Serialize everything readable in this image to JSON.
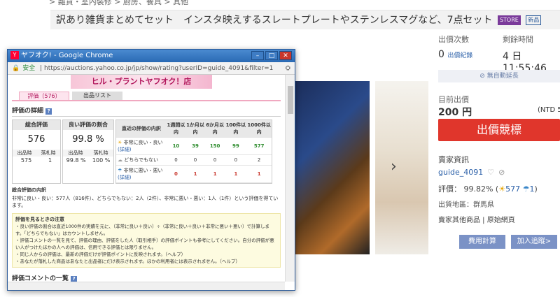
{
  "page": {
    "breadcrumb": "> 雜貨・室內裝修 > 廚房、餐具 > 其他",
    "title": "訳あり雑貨まとめてセット　インスタ映えするスレートプレートやステンレスマグなど、7点セット",
    "badge_store": "STORE",
    "badge_new": "新品"
  },
  "panel": {
    "bids_label": "出價次數",
    "bids_value": "0",
    "bids_link": "出價紀錄",
    "time_label": "剩餘時間",
    "time_value": "4 日 11:55:46",
    "auto_extend": "無自動延長",
    "current_label": "目前出價",
    "current_value": "200 円",
    "ntd": "(NTD 5",
    "bid_button": "出價競標",
    "seller_title": "賣家資訊",
    "seller_name": "guide_4091",
    "rating_prefix": "評價： 99.82% (",
    "rating_pos": "577",
    "rating_neg": "1",
    "rating_suffix": ")",
    "location": "出貨地區：群馬県",
    "other_goods": "賣家其他商品 | 原始網頁",
    "calc_button": "費用計算",
    "watch_button": "加入追蹤>"
  },
  "popup": {
    "window_title": "ヤフオク! - Google Chrome",
    "secure": "安全",
    "url": "https://auctions.yahoo.co.jp/jp/show/rating?userID=guide_4091&filter=1",
    "banner": "ヒル・プラントヤフオク！店",
    "tab_rating": "評価（576）",
    "tab_list": "出品リスト",
    "details_heading": "評価の詳細",
    "overall_label": "総合評価",
    "overall_value": "576",
    "good_ratio_label": "良い評価の割合",
    "good_ratio_value": "99.8 %",
    "seller_col": "出品時",
    "buyer_col": "落札時",
    "seller_count": "575",
    "buyer_count": "1",
    "seller_ratio": "99.8 %",
    "buyer_ratio": "100 %",
    "recent_header": "直近の評価の内訳",
    "periods": [
      "1週間以内",
      "1か月以内",
      "6か月以内",
      "100件以内",
      "1000件以内"
    ],
    "rows": [
      {
        "label": "非常に良い・良い",
        "link": "(詳細)",
        "values": [
          "10",
          "39",
          "150",
          "99",
          "577"
        ]
      },
      {
        "label": "どちらでもない",
        "link": "",
        "values": [
          "0",
          "0",
          "0",
          "0",
          "2"
        ]
      },
      {
        "label": "非常に悪い・悪い",
        "link": "(詳細)",
        "values": [
          "0",
          "1",
          "1",
          "1",
          "1"
        ]
      }
    ],
    "breakdown_heading": "総合評価の内訳",
    "breakdown_text": "非常に良い・良い：577人（816件）、どちらでもない：2人（2件）、非常に悪い・悪い：1人（1件）という評価を得ています。",
    "notes_heading": "評価を見るときの注意",
    "notes": [
      "・良い評価の割合は直近1000件の実績を元に、（非常に良い＋良い）÷（非常に良い＋良い＋非常に悪い＋悪い）で計算します。「どちらでもない」はカウントしません。",
      "・評価コメントの一覧を見て、評価の理由、評価をした人（取引相手）の評価ポイントも参考にしてください。自分の評価が悪い人がつけたほかの人への評価は、信用できる評価とは限りません。",
      "・同じ人からの評価は、最新の評価だけが評価ポイントに反映されます。（ヘルプ）",
      "・あなたが落札した商品はあなたと出品者にだけ表示されます。ほかの利用者には表示されません。（ヘルプ）"
    ],
    "comments_heading": "評価コメントの一覧"
  },
  "colors": {
    "accent_red": "#e0362c",
    "link_blue": "#2a5fa8",
    "pink": "#f0a8c0"
  }
}
